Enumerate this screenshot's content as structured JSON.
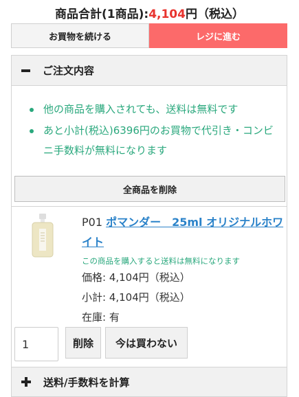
{
  "summary": {
    "label": "商品合計(1商品):",
    "amount": "4,104",
    "suffix": "円（税込）"
  },
  "buttons": {
    "continue_shopping": "お買物を続ける",
    "checkout": "レジに進む"
  },
  "order": {
    "title": "ご注文内容",
    "toggle_icon": "minus-icon",
    "notes": [
      "他の商品を購入されても、送料は無料です",
      "あと小計(税込)6396円のお買物で代引き・コンビニ手数料が無料になります"
    ],
    "delete_all_label": "全商品を削除"
  },
  "item": {
    "code": "P01",
    "name": "ポマンダー　25ml オリジナルホワイト",
    "free_note": "この商品を購入すると送料は無料になります",
    "price": "価格: 4,104円（税込）",
    "subtotal": "小計: 4,104円（税込）",
    "stock": "在庫: 有",
    "quantity": "1",
    "remove_label": "削除",
    "later_label": "今は買わない"
  },
  "shipping": {
    "label": "送料/手数料を計算",
    "toggle_icon": "plus-icon"
  },
  "colors": {
    "accent_red": "#fc6a6a",
    "price_red": "#e8342f",
    "note_green": "#2aa87d",
    "link_blue": "#2a82c9"
  }
}
